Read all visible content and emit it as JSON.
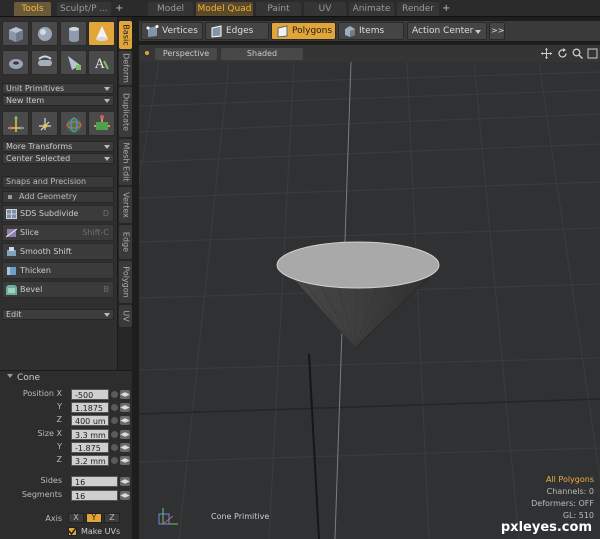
{
  "top_tabs": {
    "tools": "Tools",
    "sculpt": "Sculpt/P ...",
    "model": "Model",
    "model_quad": "Model Quad",
    "paint": "Paint",
    "uv": "UV",
    "animate": "Animate",
    "render": "Render",
    "plus": "+"
  },
  "vertical_tabs": [
    "Basic",
    "Deform",
    "Duplicate",
    "Mesh Edit",
    "Vertex",
    "Edge",
    "Polygon",
    "UV"
  ],
  "left_panel": {
    "unit_primitives": "Unit Primitives",
    "new_item": "New Item",
    "more_transforms": "More Transforms",
    "center_selected": "Center Selected",
    "snaps": "Snaps and Precision",
    "add_geometry": "Add Geometry",
    "geometry_tools": [
      {
        "label": "SDS Subdivide",
        "shortcut": "D"
      },
      {
        "label": "Slice",
        "shortcut": "Shift-C"
      },
      {
        "label": "Smooth Shift",
        "shortcut": ""
      },
      {
        "label": "Thicken",
        "shortcut": ""
      },
      {
        "label": "Bevel",
        "shortcut": "B"
      }
    ],
    "edit": "Edit"
  },
  "properties": {
    "title": "Cone",
    "position_label": "Position X",
    "y_label": "Y",
    "z_label": "Z",
    "size_label": "Size X",
    "position": {
      "x": "-500 um",
      "y": "1.1875",
      "z": "400 um"
    },
    "size": {
      "x": "3.3 mm",
      "y": "-1.875",
      "z": "3.2 mm"
    },
    "sides_label": "Sides",
    "sides": "16",
    "segments_label": "Segments",
    "segments": "16",
    "axis_label": "Axis",
    "axis": [
      "X",
      "Y",
      "Z"
    ],
    "make_uvs": "Make UVs"
  },
  "toolbar": {
    "vertices": "Vertices",
    "edges": "Edges",
    "polygons": "Polygons",
    "items": "Items",
    "action_center": "Action Center",
    "more": ">>"
  },
  "viewport": {
    "perspective": "Perspective",
    "shaded": "Shaded",
    "primitive_label": "Cone Primitive",
    "stats": {
      "all_polygons": "All Polygons",
      "channels": "Channels: 0",
      "deformers": "Deformers: OFF",
      "gl": "GL: 510"
    }
  },
  "watermark": "pxleyes.com",
  "colors": {
    "accent": "#e2a53a",
    "selection_text": "#f0b040"
  }
}
